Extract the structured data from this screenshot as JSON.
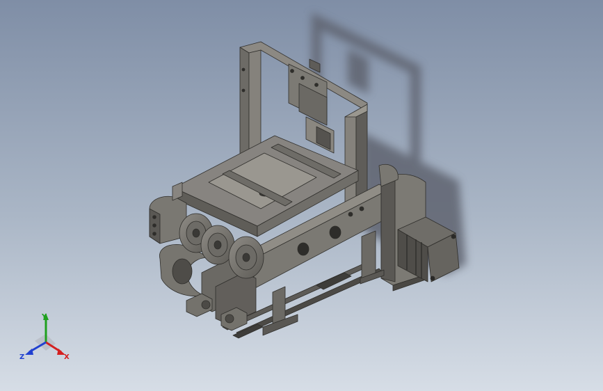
{
  "viewport": {
    "background_top": "#7f8ea6",
    "background_bottom": "#d6dde6",
    "model_color": "#6f6d68",
    "model_highlight": "#908d87",
    "model_shadow": "#4a4844",
    "shadow_color": "#5e6470"
  },
  "triad": {
    "x_label": "X",
    "y_label": "Y",
    "z_label": "Z",
    "x_color": "#d42020",
    "y_color": "#1fa01f",
    "z_color": "#2040d0"
  }
}
